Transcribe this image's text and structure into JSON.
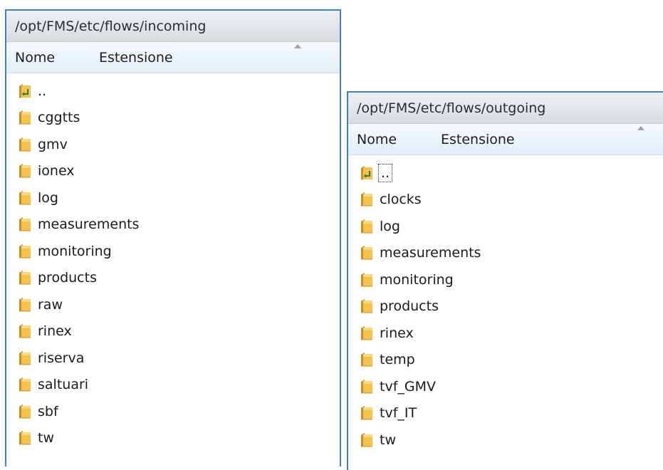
{
  "panels": [
    {
      "id": "incoming",
      "path": "/opt/FMS/etc/flows/incoming",
      "columns": {
        "name": "Nome",
        "extension": "Estensione"
      },
      "items": [
        {
          "label": "..",
          "type": "parent"
        },
        {
          "label": "cggtts",
          "type": "folder"
        },
        {
          "label": "gmv",
          "type": "folder"
        },
        {
          "label": "ionex",
          "type": "folder"
        },
        {
          "label": "log",
          "type": "folder"
        },
        {
          "label": "measurements",
          "type": "folder"
        },
        {
          "label": "monitoring",
          "type": "folder"
        },
        {
          "label": "products",
          "type": "folder"
        },
        {
          "label": "raw",
          "type": "folder"
        },
        {
          "label": "rinex",
          "type": "folder"
        },
        {
          "label": "riserva",
          "type": "folder"
        },
        {
          "label": "saltuari",
          "type": "folder"
        },
        {
          "label": "sbf",
          "type": "folder"
        },
        {
          "label": "tw",
          "type": "folder"
        }
      ]
    },
    {
      "id": "outgoing",
      "path": "/opt/FMS/etc/flows/outgoing",
      "columns": {
        "name": "Nome",
        "extension": "Estensione"
      },
      "items": [
        {
          "label": "..",
          "type": "parent",
          "focused": true
        },
        {
          "label": "clocks",
          "type": "folder"
        },
        {
          "label": "log",
          "type": "folder"
        },
        {
          "label": "measurements",
          "type": "folder"
        },
        {
          "label": "monitoring",
          "type": "folder"
        },
        {
          "label": "products",
          "type": "folder"
        },
        {
          "label": "rinex",
          "type": "folder"
        },
        {
          "label": "temp",
          "type": "folder"
        },
        {
          "label": "tvf_GMV",
          "type": "folder"
        },
        {
          "label": "tvf_IT",
          "type": "folder"
        },
        {
          "label": "tw",
          "type": "folder"
        }
      ]
    }
  ],
  "icons": {
    "folder": "folder-icon",
    "parent": "parent-directory-icon"
  },
  "colors": {
    "window_border": "#3f7fd1",
    "folder_yellow": "#f3c24f",
    "parent_arrow": "#2e7d32"
  }
}
